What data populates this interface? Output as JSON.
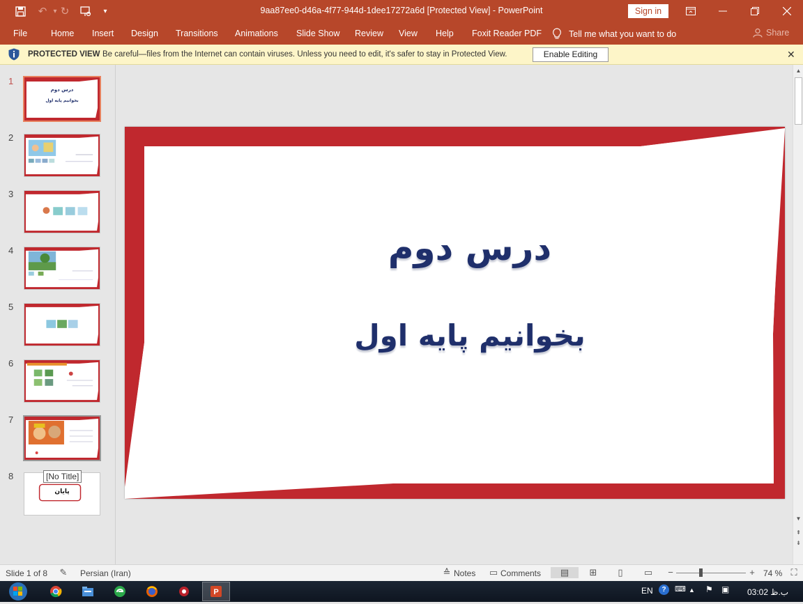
{
  "window": {
    "title": "9aa87ee0-d46a-4f77-944d-1dee17272a6d [Protected View] - PowerPoint",
    "sign_in": "Sign in"
  },
  "ribbon": {
    "tabs": [
      "File",
      "Home",
      "Insert",
      "Design",
      "Transitions",
      "Animations",
      "Slide Show",
      "Review",
      "View",
      "Help",
      "Foxit Reader PDF"
    ],
    "tell_me": "Tell me what you want to do",
    "share": "Share"
  },
  "protected_view": {
    "title": "PROTECTED VIEW",
    "message": "Be careful—files from the Internet can contain viruses. Unless you need to edit, it's safer to stay in Protected View.",
    "enable_button": "Enable Editing"
  },
  "thumbnails": {
    "numbers": [
      "1",
      "2",
      "3",
      "4",
      "5",
      "6",
      "7",
      "8"
    ],
    "slide1_title": "درس دوم",
    "slide1_subtitle": "بخوانیم پایه اول",
    "slide8_text": "پایان",
    "tooltip": "[No Title]"
  },
  "slide": {
    "title": "درس دوم",
    "subtitle": "بخوانیم پایه اول",
    "frame_color": "#c0282e",
    "text_color": "#1f2f6b"
  },
  "statusbar": {
    "slide_counter": "Slide 1 of 8",
    "language": "Persian (Iran)",
    "notes": "Notes",
    "comments": "Comments",
    "zoom": "74 %"
  },
  "taskbar": {
    "language": "EN",
    "time": "03:02 ب.ظ"
  }
}
